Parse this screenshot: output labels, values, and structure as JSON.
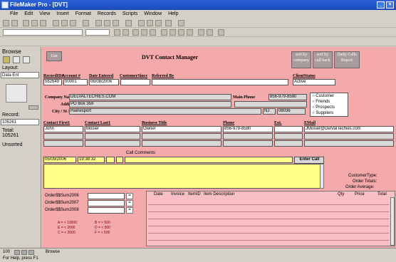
{
  "window": {
    "title": "FileMaker Pro - [DVT]"
  },
  "menu": [
    "File",
    "Edit",
    "View",
    "Insert",
    "Format",
    "Records",
    "Scripts",
    "Window",
    "Help"
  ],
  "left_panel": {
    "mode": "Browse",
    "layout_label": "Layout:",
    "layout_value": "Data Ent",
    "record_label": "Record:",
    "record_value": "105261",
    "total_label": "Total:",
    "total_value": "105261",
    "sort_state": "Unsorted"
  },
  "header": {
    "list_button": "List",
    "title": "DVT Contact Manager",
    "sort_company": "sort by company",
    "sort_callback": "sort by call back",
    "daily_calls": "Daily Calls Report"
  },
  "record": {
    "labels": {
      "record_id": "RecordID#",
      "account": "Account #",
      "date_entered": "Date Entered",
      "customer_since": "CustomerSince",
      "referred_by": "Referred By",
      "client_status": "ClientStatus",
      "company_name": "Company Name",
      "address": "Address",
      "city_st_zip": "City / St / Zip",
      "main_phone": "Main Phone"
    },
    "values": {
      "record_id": "562649",
      "account": "00001",
      "date_entered": "06/08/2006",
      "customer_since": "",
      "referred_by": "",
      "client_status": "Active",
      "company_name": "DELVALTECHIES.COM",
      "address": "PO Box 359",
      "city": "Hainesport",
      "state": "NJ",
      "zip": "08036",
      "main_phone": "856-979-8580"
    },
    "radio_options": [
      "Customer",
      "Friends",
      "Prospects",
      "Suppliers"
    ]
  },
  "contact": {
    "headers": [
      "Contact First1",
      "Contact Last1",
      "Business Title",
      "Phone",
      "Ext.",
      "EMail"
    ],
    "rows": [
      [
        "John",
        "Mosier",
        "Owner",
        "856-979-8580",
        "",
        "JMosier@DelValTechies.com"
      ],
      [
        "",
        "",
        "",
        "",
        "",
        ""
      ],
      [
        "",
        "",
        "",
        "",
        "",
        ""
      ]
    ]
  },
  "call": {
    "label": "Call Comments",
    "date": "05/09/2006",
    "time": "19:38:32",
    "enter_button": "Enter Call"
  },
  "order_summary": {
    "customer_type_label": "CustomerType:",
    "order_totals_label": "Order Totals:",
    "order_average_label": "Order Average:"
  },
  "sums": {
    "rows": [
      "Order$$Sum2006",
      "Order$$Sum2007",
      "Order$$Sum2008"
    ],
    "legend": [
      "A = > 10000",
      "B = > 500",
      "E = < 2000",
      "D = < 500",
      "C = < 2000",
      "F = < 500"
    ]
  },
  "invoice": {
    "headers": [
      "Date",
      "Invoice",
      "ItemID",
      "Item Description",
      "Qty",
      "Price",
      "Total"
    ]
  },
  "status": {
    "zoom": "100",
    "mode": "Browse",
    "help": "For Help, press F1"
  },
  "colors": {
    "form_bg": "#f4a9aa",
    "call_yellow": "#ffff8a",
    "titlebar": "#1b49b8",
    "button_gray": "#a99b9b"
  }
}
